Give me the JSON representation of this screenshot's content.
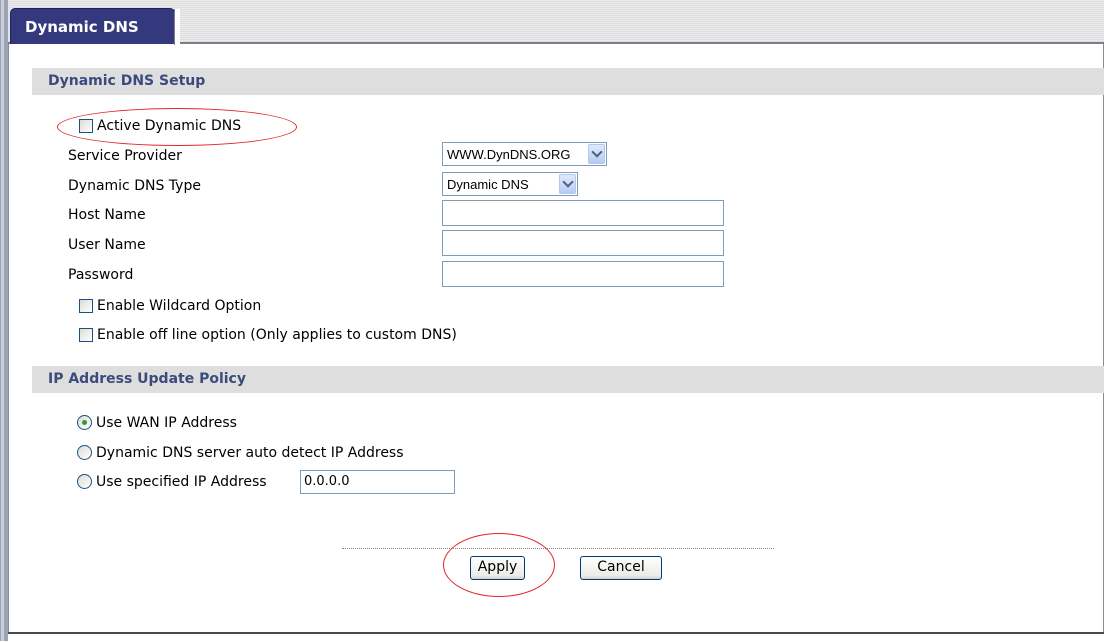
{
  "tab": {
    "label": "Dynamic DNS"
  },
  "setup": {
    "title": "Dynamic DNS Setup",
    "active_label": "Active Dynamic DNS",
    "service_provider_label": "Service Provider",
    "service_provider_value": "WWW.DynDNS.ORG",
    "dns_type_label": "Dynamic DNS Type",
    "dns_type_value": "Dynamic DNS",
    "host_name_label": "Host Name",
    "host_name_value": "",
    "user_name_label": "User Name",
    "user_name_value": "",
    "password_label": "Password",
    "password_value": "",
    "wildcard_label": "Enable Wildcard Option",
    "offline_label": "Enable off line option (Only applies to custom DNS)"
  },
  "policy": {
    "title": "IP Address Update Policy",
    "options": [
      {
        "label": "Use WAN IP Address",
        "checked": true
      },
      {
        "label": "Dynamic DNS server auto detect IP Address",
        "checked": false
      },
      {
        "label": "Use specified IP Address",
        "checked": false
      }
    ],
    "specified_ip_value": "0.0.0.0"
  },
  "buttons": {
    "apply": "Apply",
    "cancel": "Cancel"
  },
  "colors": {
    "tab_bg": "#34397e",
    "section_bar": "#dedede",
    "section_title": "#3d4a7c",
    "highlight_ellipse": "#e2252b",
    "radio_selected": "#2e9b3a"
  }
}
